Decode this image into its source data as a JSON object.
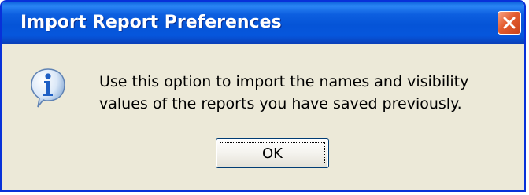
{
  "dialog": {
    "title": "Import Report Preferences",
    "message": "Use this option to import the names and visibility values of the reports you have saved previously.",
    "ok_label": "OK",
    "icons": {
      "info": "information-icon",
      "close": "close-icon"
    }
  },
  "colors": {
    "titlebar_blue": "#0554d7",
    "dialog_face": "#ece9d8",
    "close_red": "#e35b2e",
    "button_border": "#003c74"
  }
}
